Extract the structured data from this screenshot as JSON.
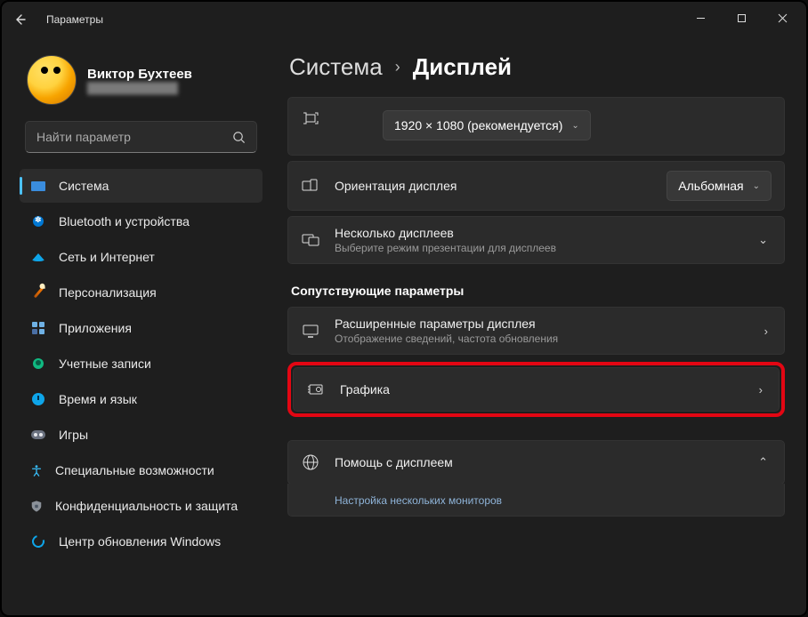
{
  "window": {
    "title": "Параметры"
  },
  "profile": {
    "name": "Виктор Бухтеев",
    "email": "████████████"
  },
  "search": {
    "placeholder": "Найти параметр"
  },
  "nav": {
    "system": "Система",
    "bluetooth": "Bluetooth и устройства",
    "network": "Сеть и Интернет",
    "personalization": "Персонализация",
    "apps": "Приложения",
    "accounts": "Учетные записи",
    "time": "Время и язык",
    "gaming": "Игры",
    "accessibility": "Специальные возможности",
    "privacy": "Конфиденциальность и защита",
    "update": "Центр обновления Windows"
  },
  "breadcrumb": {
    "root": "Система",
    "leaf": "Дисплей"
  },
  "resolution": {
    "selected": "1920 × 1080 (рекомендуется)"
  },
  "orientation": {
    "label": "Ориентация дисплея",
    "selected": "Альбомная"
  },
  "multi": {
    "title": "Несколько дисплеев",
    "subtitle": "Выберите режим презентации для дисплеев"
  },
  "related_section": "Сопутствующие параметры",
  "advanced": {
    "title": "Расширенные параметры дисплея",
    "subtitle": "Отображение сведений, частота обновления"
  },
  "graphics": {
    "title": "Графика"
  },
  "help": {
    "title": "Помощь с дисплеем",
    "link1": "Настройка нескольких мониторов"
  }
}
